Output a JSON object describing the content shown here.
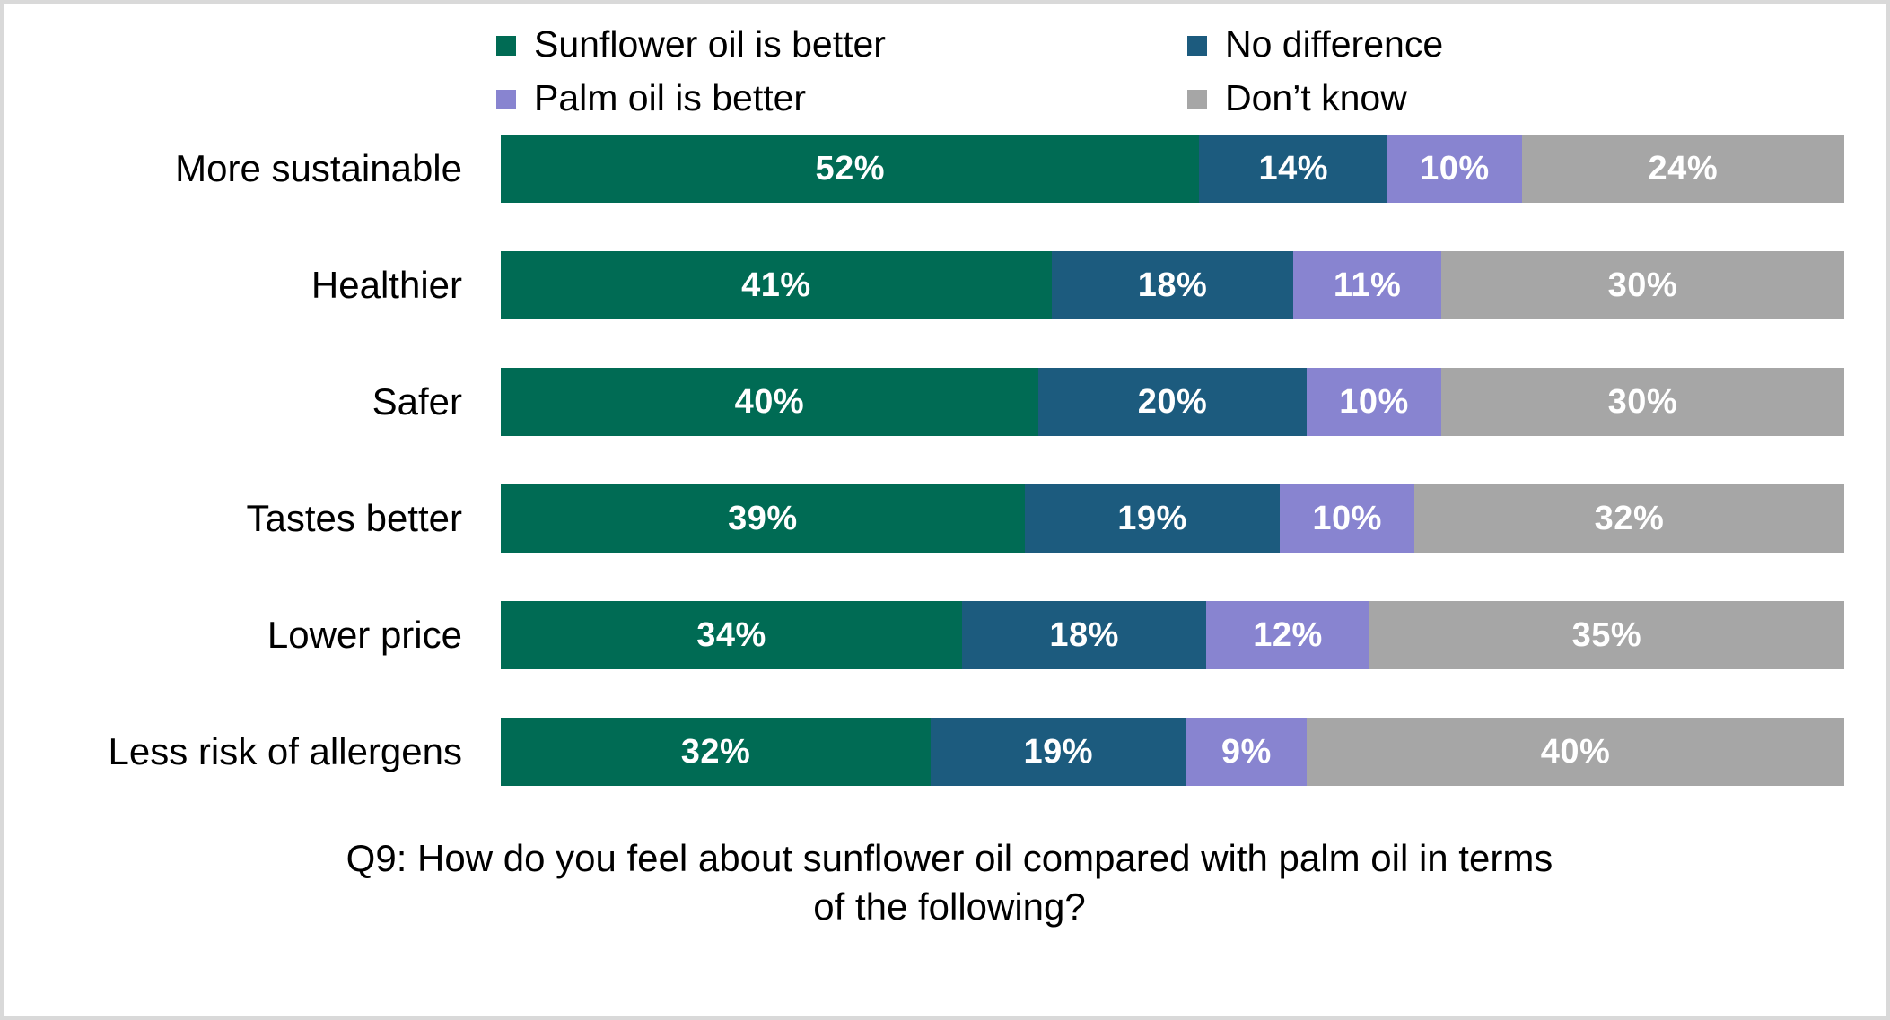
{
  "legend": {
    "items": [
      {
        "label": "Sunflower oil is better",
        "color": "#006B54",
        "marker": "square-marker"
      },
      {
        "label": "No difference",
        "color": "#1C5B7E",
        "marker": "square-marker"
      },
      {
        "label": "Palm oil is better",
        "color": "#8884D0",
        "marker": "square-marker"
      },
      {
        "label": "Don’t know",
        "color": "#A6A6A6",
        "marker": "square-marker"
      }
    ]
  },
  "caption": {
    "line1": "Q9: How do you feel about sunflower oil compared with palm oil in terms",
    "line2": "of the following?"
  },
  "chart_data": {
    "type": "bar",
    "orientation": "horizontal",
    "stacked": true,
    "stack_mode": "percent",
    "title": "",
    "subtitle": "",
    "xlabel": "",
    "ylabel": "",
    "xlim": [
      0,
      100
    ],
    "grid": false,
    "legend_position": "top",
    "categories": [
      "More sustainable",
      "Healthier",
      "Safer",
      "Tastes better",
      "Lower price",
      "Less risk of allergens"
    ],
    "series": [
      {
        "name": "Sunflower oil is better",
        "color": "#006B54",
        "values": [
          52,
          41,
          40,
          39,
          34,
          32
        ],
        "labels": [
          "52%",
          "41%",
          "40%",
          "39%",
          "34%",
          "32%"
        ]
      },
      {
        "name": "No difference",
        "color": "#1C5B7E",
        "values": [
          14,
          18,
          20,
          19,
          18,
          19
        ],
        "labels": [
          "14%",
          "18%",
          "20%",
          "19%",
          "18%",
          "19%"
        ]
      },
      {
        "name": "Palm oil is better",
        "color": "#8884D0",
        "values": [
          10,
          11,
          10,
          10,
          12,
          9
        ],
        "labels": [
          "10%",
          "11%",
          "10%",
          "10%",
          "12%",
          "9%"
        ]
      },
      {
        "name": "Don’t know",
        "color": "#A6A6A6",
        "values": [
          24,
          30,
          30,
          32,
          35,
          40
        ],
        "labels": [
          "24%",
          "30%",
          "30%",
          "32%",
          "35%",
          "40%"
        ]
      }
    ]
  }
}
